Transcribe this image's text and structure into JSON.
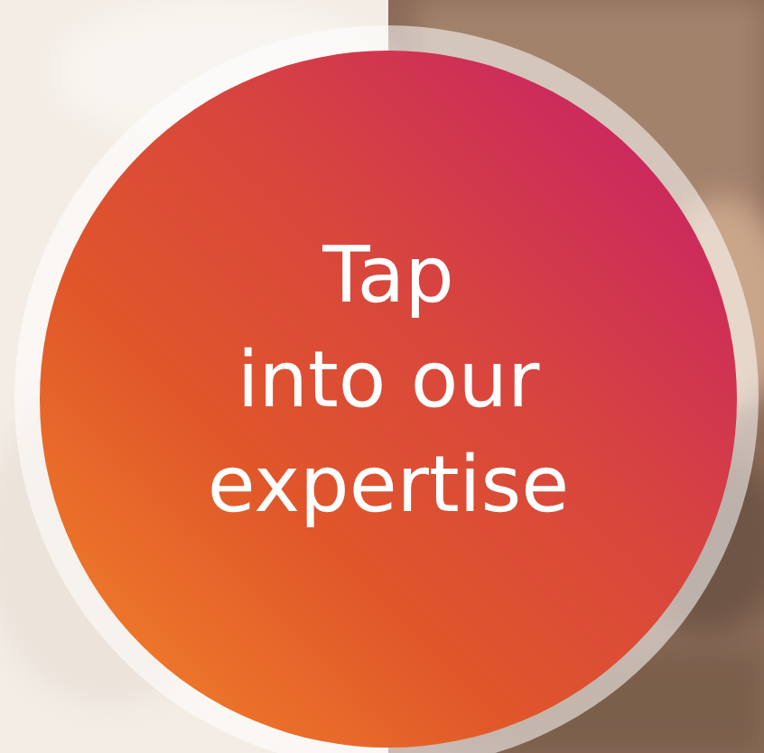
{
  "badge": {
    "headline_lines": [
      "Tap",
      "into our",
      "expertise"
    ]
  }
}
